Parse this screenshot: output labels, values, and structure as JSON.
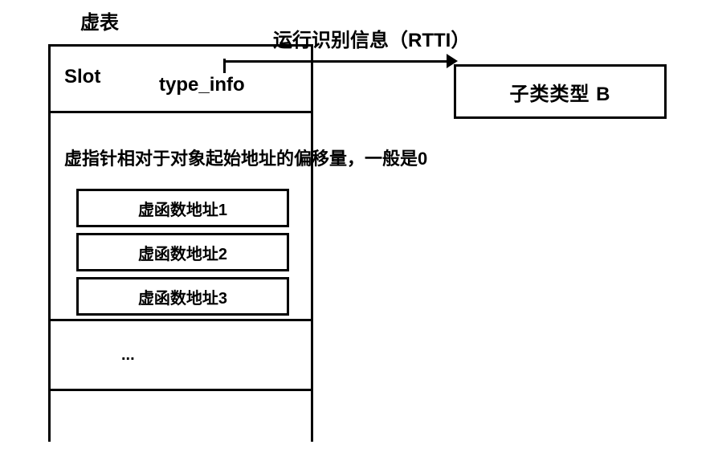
{
  "vtable": {
    "title": "虚表",
    "slot_label": "Slot",
    "type_info_label": "type_info",
    "offset_text": "虚指针相对于对象起始地址的偏移量，一般是0",
    "func_rows": {
      "f1": "虚函数地址1",
      "f2": "虚函数地址2",
      "f3": "虚函数地址3"
    },
    "ellipsis": "..."
  },
  "rtti": {
    "label": "运行识别信息（RTTI）",
    "box_text": "子类类型   B"
  }
}
